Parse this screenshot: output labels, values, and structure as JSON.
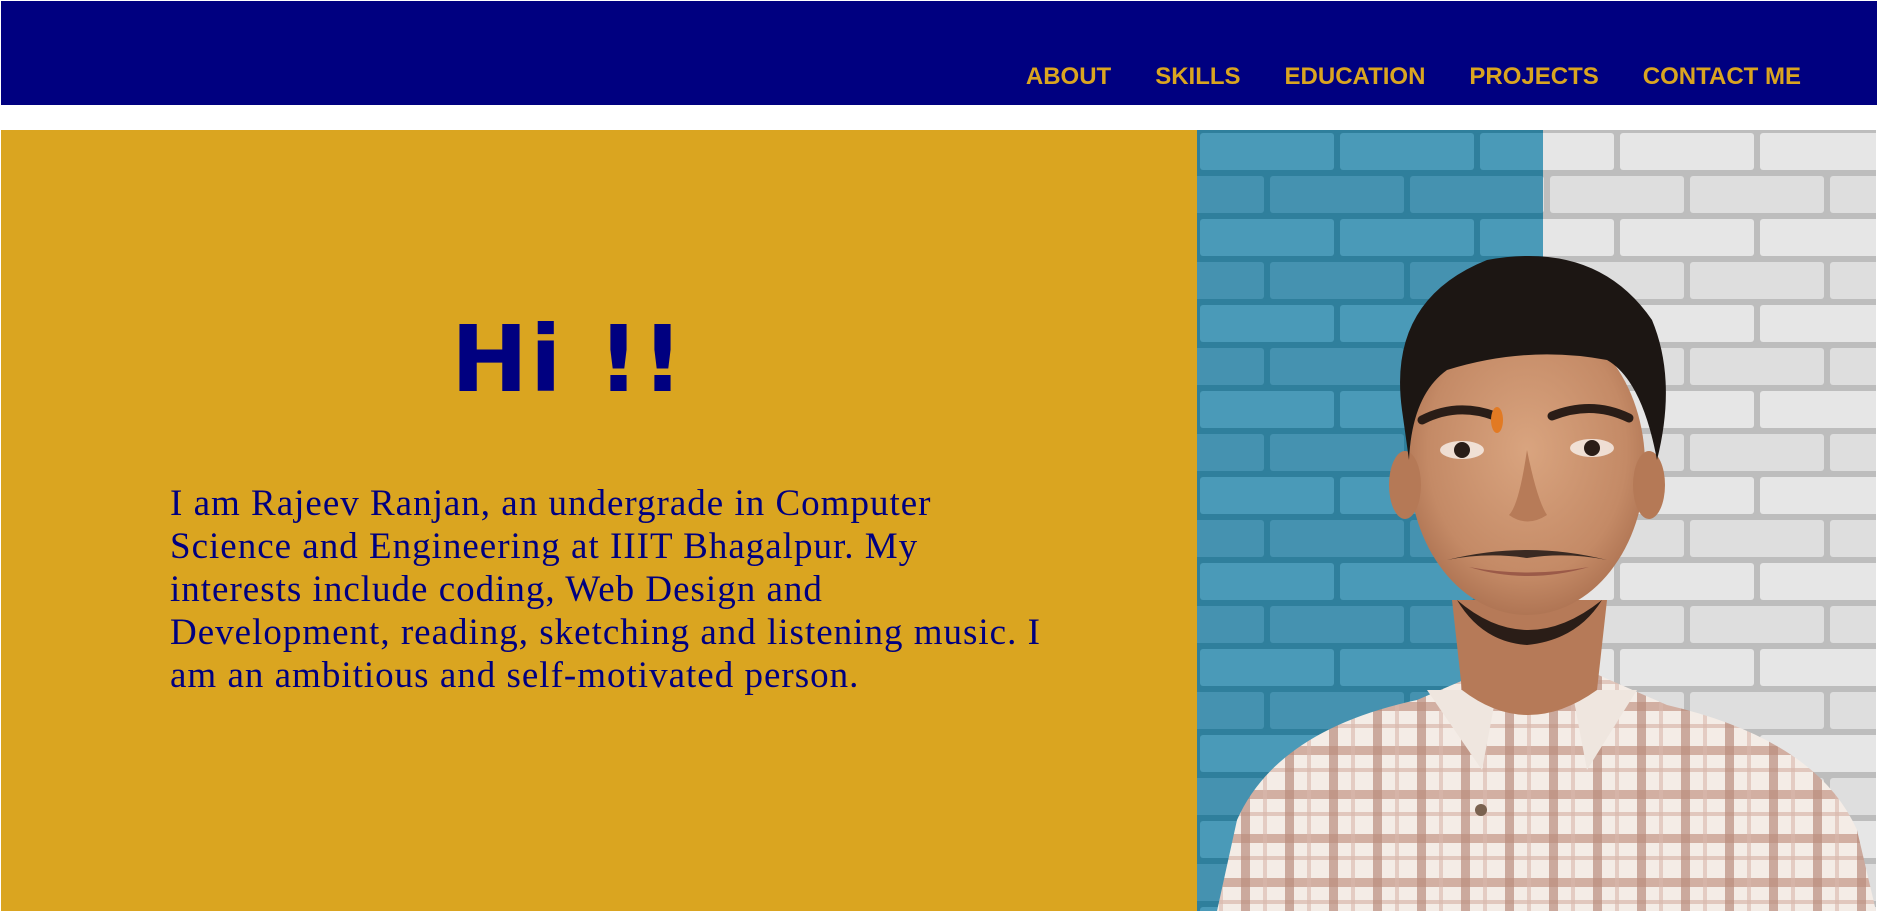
{
  "nav": {
    "items": [
      {
        "label": "ABOUT"
      },
      {
        "label": "SKILLS"
      },
      {
        "label": "EDUCATION"
      },
      {
        "label": "PROJECTS"
      },
      {
        "label": "CONTACT ME"
      }
    ]
  },
  "hero": {
    "greeting": "Hi !!",
    "intro": "I am Rajeev Ranjan, an undergrade in Computer Science and Engineering at IIIT Bhagalpur. My interests include coding, Web Design and Development, reading, sketching and listening music. I am an ambitious and self-motivated person."
  },
  "colors": {
    "navbar_bg": "#000080",
    "accent": "#daa520",
    "text_primary": "#000080",
    "brick_teal": "#4a9ab8",
    "brick_white": "#e4e4e4"
  }
}
